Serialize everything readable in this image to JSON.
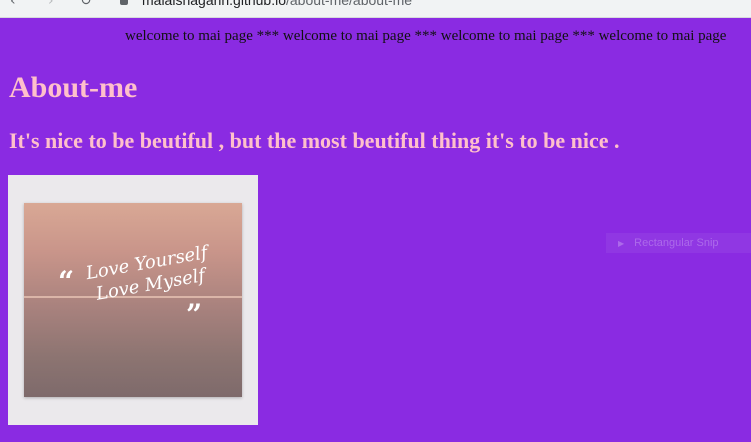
{
  "browser": {
    "url_host": "malaishagarin.github.io",
    "url_path": "/about-me/about-me",
    "icons": [
      "arrow-back-icon",
      "arrow-forward-icon",
      "reload-icon",
      "lock-icon"
    ]
  },
  "marquee": {
    "text": "welcome to mai page *** welcome to mai page *** welcome to mai page *** welcome to mai page"
  },
  "page": {
    "title": "About-me",
    "tagline": "It's nice to be beutiful , but the most beutiful thing it's to be nice ."
  },
  "image": {
    "text_line1": "Love Yourself",
    "text_line2": "Love Myself"
  },
  "ghost": {
    "label": "Rectangular Snip"
  },
  "colors": {
    "background": "#8a2be2",
    "heading": "#ffc0cb"
  }
}
